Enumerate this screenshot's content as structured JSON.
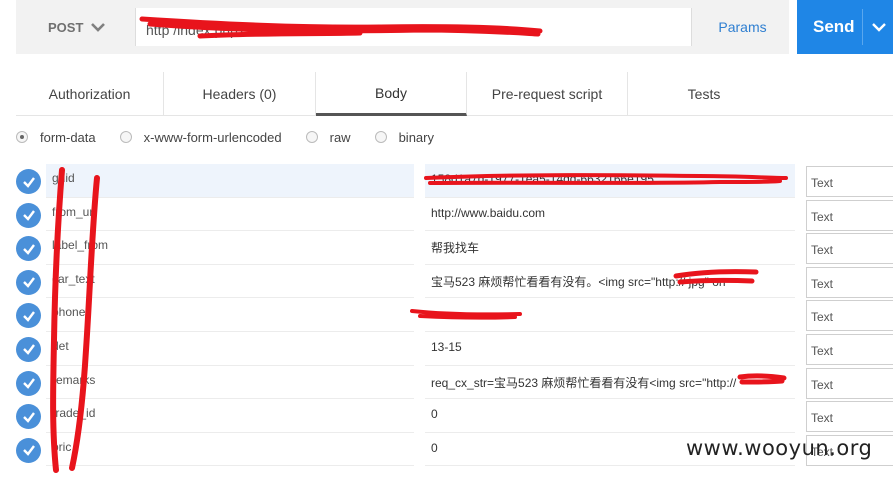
{
  "request": {
    "method": "POST",
    "url_visible": "http                              /index.php?",
    "params_label": "Params",
    "send_label": "Send"
  },
  "tabs": [
    {
      "label": "Authorization"
    },
    {
      "label": "Headers (0)"
    },
    {
      "label": "Body",
      "active": true
    },
    {
      "label": "Pre-request script"
    },
    {
      "label": "Tests"
    }
  ],
  "body_types": [
    {
      "label": "form-data",
      "checked": true
    },
    {
      "label": "x-www-form-urlencoded",
      "checked": false
    },
    {
      "label": "raw",
      "checked": false
    },
    {
      "label": "binary",
      "checked": false
    }
  ],
  "rows": [
    {
      "key": "guid",
      "value": "158d1a7d-1977-1ea5-14dd-6632166e195",
      "type": "Text"
    },
    {
      "key": "from_ur",
      "value": "http://www.baidu.com",
      "type": "Text"
    },
    {
      "key": "label_from",
      "value": "帮我找车",
      "type": "Text"
    },
    {
      "key": "car_text",
      "value": "宝马523 麻烦帮忙看看有没有。<img src=\"http://                   jpg\" on",
      "type": "Text"
    },
    {
      "key": "phone",
      "value": "",
      "type": "Text"
    },
    {
      "key": "det",
      "value": "13-15",
      "type": "Text"
    },
    {
      "key": "remarks",
      "value": "req_cx_str=宝马523 麻烦帮忙看看有没有<img src=\"http://",
      "type": "Text"
    },
    {
      "key": "trade_id",
      "value": "0",
      "type": "Text"
    },
    {
      "key": "pric",
      "value": "0",
      "type": "Text"
    }
  ],
  "watermark": "www.wooyun.org",
  "colors": {
    "accent": "#1f86e6",
    "check": "#4a90d9",
    "redaction": "#e8141c"
  }
}
